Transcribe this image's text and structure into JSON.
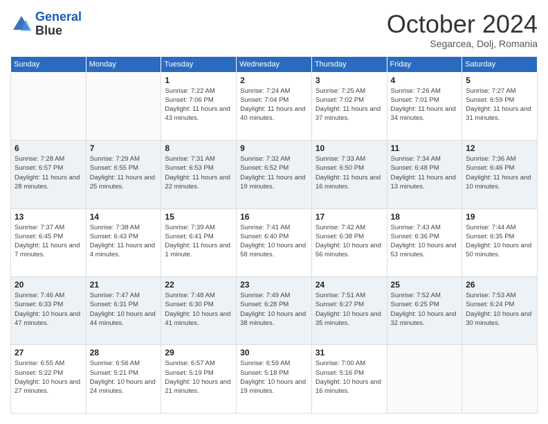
{
  "header": {
    "logo_line1": "General",
    "logo_line2": "Blue",
    "month": "October 2024",
    "location": "Segarcea, Dolj, Romania"
  },
  "days_of_week": [
    "Sunday",
    "Monday",
    "Tuesday",
    "Wednesday",
    "Thursday",
    "Friday",
    "Saturday"
  ],
  "weeks": [
    [
      {
        "day": "",
        "info": ""
      },
      {
        "day": "",
        "info": ""
      },
      {
        "day": "1",
        "info": "Sunrise: 7:22 AM\nSunset: 7:06 PM\nDaylight: 11 hours and 43 minutes."
      },
      {
        "day": "2",
        "info": "Sunrise: 7:24 AM\nSunset: 7:04 PM\nDaylight: 11 hours and 40 minutes."
      },
      {
        "day": "3",
        "info": "Sunrise: 7:25 AM\nSunset: 7:02 PM\nDaylight: 11 hours and 37 minutes."
      },
      {
        "day": "4",
        "info": "Sunrise: 7:26 AM\nSunset: 7:01 PM\nDaylight: 11 hours and 34 minutes."
      },
      {
        "day": "5",
        "info": "Sunrise: 7:27 AM\nSunset: 6:59 PM\nDaylight: 11 hours and 31 minutes."
      }
    ],
    [
      {
        "day": "6",
        "info": "Sunrise: 7:28 AM\nSunset: 6:57 PM\nDaylight: 11 hours and 28 minutes."
      },
      {
        "day": "7",
        "info": "Sunrise: 7:29 AM\nSunset: 6:55 PM\nDaylight: 11 hours and 25 minutes."
      },
      {
        "day": "8",
        "info": "Sunrise: 7:31 AM\nSunset: 6:53 PM\nDaylight: 11 hours and 22 minutes."
      },
      {
        "day": "9",
        "info": "Sunrise: 7:32 AM\nSunset: 6:52 PM\nDaylight: 11 hours and 19 minutes."
      },
      {
        "day": "10",
        "info": "Sunrise: 7:33 AM\nSunset: 6:50 PM\nDaylight: 11 hours and 16 minutes."
      },
      {
        "day": "11",
        "info": "Sunrise: 7:34 AM\nSunset: 6:48 PM\nDaylight: 11 hours and 13 minutes."
      },
      {
        "day": "12",
        "info": "Sunrise: 7:36 AM\nSunset: 6:46 PM\nDaylight: 11 hours and 10 minutes."
      }
    ],
    [
      {
        "day": "13",
        "info": "Sunrise: 7:37 AM\nSunset: 6:45 PM\nDaylight: 11 hours and 7 minutes."
      },
      {
        "day": "14",
        "info": "Sunrise: 7:38 AM\nSunset: 6:43 PM\nDaylight: 11 hours and 4 minutes."
      },
      {
        "day": "15",
        "info": "Sunrise: 7:39 AM\nSunset: 6:41 PM\nDaylight: 11 hours and 1 minute."
      },
      {
        "day": "16",
        "info": "Sunrise: 7:41 AM\nSunset: 6:40 PM\nDaylight: 10 hours and 58 minutes."
      },
      {
        "day": "17",
        "info": "Sunrise: 7:42 AM\nSunset: 6:38 PM\nDaylight: 10 hours and 56 minutes."
      },
      {
        "day": "18",
        "info": "Sunrise: 7:43 AM\nSunset: 6:36 PM\nDaylight: 10 hours and 53 minutes."
      },
      {
        "day": "19",
        "info": "Sunrise: 7:44 AM\nSunset: 6:35 PM\nDaylight: 10 hours and 50 minutes."
      }
    ],
    [
      {
        "day": "20",
        "info": "Sunrise: 7:46 AM\nSunset: 6:33 PM\nDaylight: 10 hours and 47 minutes."
      },
      {
        "day": "21",
        "info": "Sunrise: 7:47 AM\nSunset: 6:31 PM\nDaylight: 10 hours and 44 minutes."
      },
      {
        "day": "22",
        "info": "Sunrise: 7:48 AM\nSunset: 6:30 PM\nDaylight: 10 hours and 41 minutes."
      },
      {
        "day": "23",
        "info": "Sunrise: 7:49 AM\nSunset: 6:28 PM\nDaylight: 10 hours and 38 minutes."
      },
      {
        "day": "24",
        "info": "Sunrise: 7:51 AM\nSunset: 6:27 PM\nDaylight: 10 hours and 35 minutes."
      },
      {
        "day": "25",
        "info": "Sunrise: 7:52 AM\nSunset: 6:25 PM\nDaylight: 10 hours and 32 minutes."
      },
      {
        "day": "26",
        "info": "Sunrise: 7:53 AM\nSunset: 6:24 PM\nDaylight: 10 hours and 30 minutes."
      }
    ],
    [
      {
        "day": "27",
        "info": "Sunrise: 6:55 AM\nSunset: 5:22 PM\nDaylight: 10 hours and 27 minutes."
      },
      {
        "day": "28",
        "info": "Sunrise: 6:56 AM\nSunset: 5:21 PM\nDaylight: 10 hours and 24 minutes."
      },
      {
        "day": "29",
        "info": "Sunrise: 6:57 AM\nSunset: 5:19 PM\nDaylight: 10 hours and 21 minutes."
      },
      {
        "day": "30",
        "info": "Sunrise: 6:59 AM\nSunset: 5:18 PM\nDaylight: 10 hours and 19 minutes."
      },
      {
        "day": "31",
        "info": "Sunrise: 7:00 AM\nSunset: 5:16 PM\nDaylight: 10 hours and 16 minutes."
      },
      {
        "day": "",
        "info": ""
      },
      {
        "day": "",
        "info": ""
      }
    ]
  ]
}
